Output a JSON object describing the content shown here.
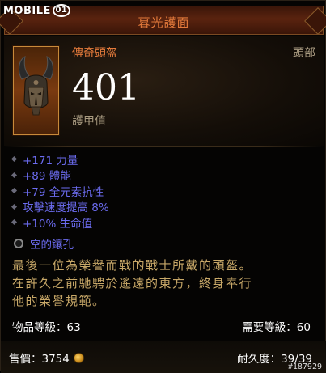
{
  "watermark": {
    "text": "MOBILE",
    "suffix": "01"
  },
  "item": {
    "name": "暮光護面",
    "type": "傳奇頭盔",
    "slot": "頭部",
    "armor_value": "401",
    "armor_label": "護甲值"
  },
  "stats": [
    {
      "text": "+171 力量"
    },
    {
      "text": "+89 體能"
    },
    {
      "text": "+79 全元素抗性"
    },
    {
      "text": "攻擊速度提高 8%"
    },
    {
      "text": "+10% 生命值"
    }
  ],
  "socket": {
    "label": "空的鑲孔"
  },
  "flavor": [
    "最後一位為榮譽而戰的戰士所戴的頭盔。",
    "在許久之前馳騁於遙遠的東方，終身奉行",
    "他的榮譽規範。"
  ],
  "levels": {
    "item_level": "物品等級：63",
    "required_level": "需要等級：60"
  },
  "footer": {
    "price": "售價：3754",
    "durability": "耐久度：39/39",
    "tag": "#187929"
  },
  "colors": {
    "legendary": "#e37a3b",
    "magic_stat": "#6c6cf0",
    "flavor": "#c8a868",
    "label": "#a89a80"
  },
  "icons": {
    "price": "gold-coin-icon",
    "socket": "empty-socket-icon",
    "helm": "helm-item-icon"
  }
}
